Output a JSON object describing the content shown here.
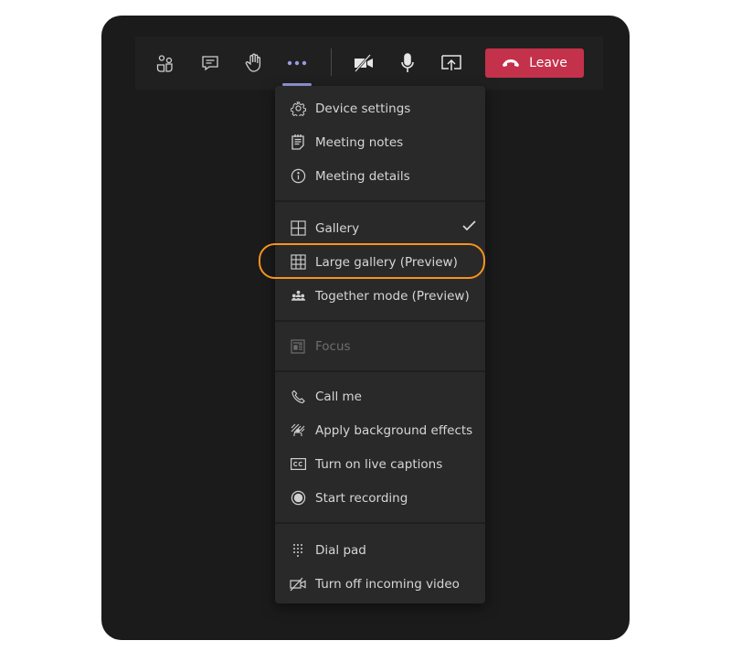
{
  "toolbar": {
    "buttons": [
      {
        "name": "participants",
        "icon": "people-icon"
      },
      {
        "name": "chat",
        "icon": "chat-icon"
      },
      {
        "name": "raise-hand",
        "icon": "hand-icon"
      },
      {
        "name": "more-actions",
        "icon": "more-icon",
        "active": true
      },
      {
        "name": "camera",
        "icon": "camera-off-icon"
      },
      {
        "name": "microphone",
        "icon": "mic-icon"
      },
      {
        "name": "share",
        "icon": "share-screen-icon"
      }
    ],
    "leave_label": "Leave",
    "leave_color": "#c4314b",
    "active_indicator_color": "#9a9be4"
  },
  "menu": {
    "sections": [
      {
        "items": [
          {
            "label": "Device settings",
            "icon": "gear-icon"
          },
          {
            "label": "Meeting notes",
            "icon": "notes-icon"
          },
          {
            "label": "Meeting details",
            "icon": "info-icon"
          }
        ]
      },
      {
        "items": [
          {
            "label": "Gallery",
            "icon": "grid-icon",
            "checked": true
          },
          {
            "label": "Large gallery (Preview)",
            "icon": "large-grid-icon",
            "highlighted": true
          },
          {
            "label": "Together mode (Preview)",
            "icon": "together-icon"
          }
        ]
      },
      {
        "items": [
          {
            "label": "Focus",
            "icon": "focus-icon",
            "disabled": true
          }
        ]
      },
      {
        "items": [
          {
            "label": "Call me",
            "icon": "phone-icon"
          },
          {
            "label": "Apply background effects",
            "icon": "background-effects-icon"
          },
          {
            "label": "Turn on live captions",
            "icon": "captions-icon"
          },
          {
            "label": "Start recording",
            "icon": "record-icon"
          }
        ]
      },
      {
        "items": [
          {
            "label": "Dial pad",
            "icon": "dialpad-icon"
          },
          {
            "label": "Turn off incoming video",
            "icon": "video-off-icon"
          }
        ]
      }
    ],
    "highlight_color": "#f7931e"
  }
}
